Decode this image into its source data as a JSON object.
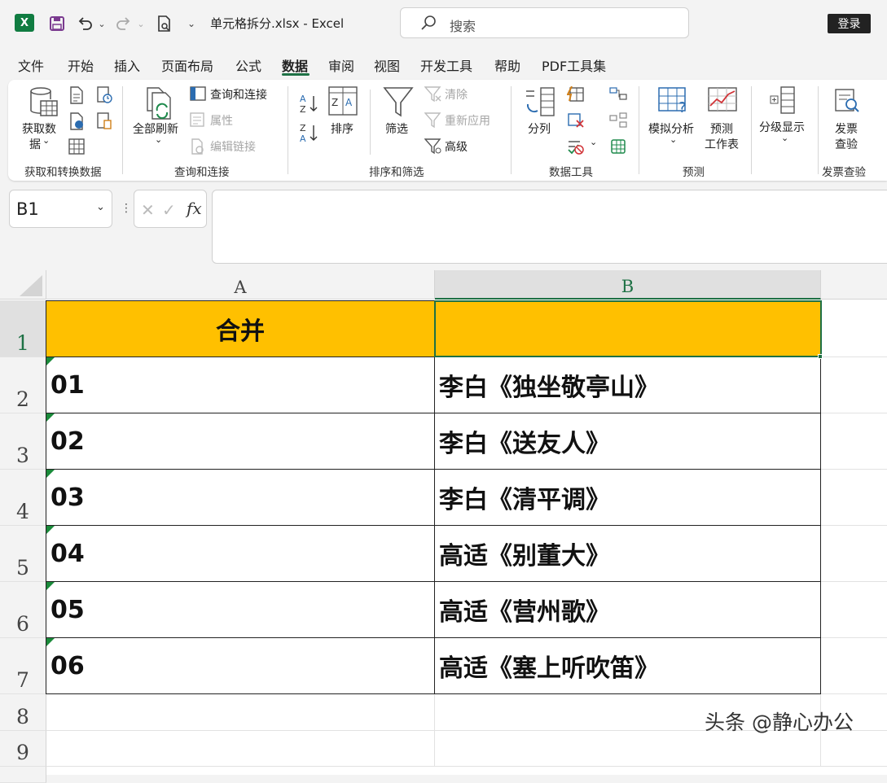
{
  "titlebar": {
    "app_logo": "X",
    "filename": "单元格拆分.xlsx  -  Excel",
    "search_placeholder": "搜索",
    "login": "登录"
  },
  "tabs": [
    "文件",
    "开始",
    "插入",
    "页面布局",
    "公式",
    "数据",
    "审阅",
    "视图",
    "开发工具",
    "帮助",
    "PDF工具集"
  ],
  "active_tab": "数据",
  "ribbon": {
    "get_data": "获取数",
    "get_data2": "据",
    "refresh_all": "全部刷新",
    "queries_connections": "查询和连接",
    "properties": "属性",
    "edit_links": "编辑链接",
    "sort": "排序",
    "filter": "筛选",
    "clear": "清除",
    "reapply": "重新应用",
    "advanced": "高级",
    "text_to_columns": "分列",
    "what_if": "模拟分析",
    "forecast_sheet": "预测",
    "forecast_sheet2": "工作表",
    "outline": "分级显示",
    "invoice_check": "发票",
    "invoice_check2": "查验",
    "groups": [
      "获取和转换数据",
      "查询和连接",
      "排序和筛选",
      "数据工具",
      "预测",
      "发票查验"
    ]
  },
  "formula_bar": {
    "name_box": "B1",
    "fx": "fx",
    "formula": ""
  },
  "sheet": {
    "columns": [
      "A",
      "B"
    ],
    "rows": [
      "1",
      "2",
      "3",
      "4",
      "5",
      "6",
      "7",
      "8",
      "9"
    ],
    "header_a": "合并",
    "header_b": "",
    "data": [
      [
        "01",
        "李白《独坐敬亭山》"
      ],
      [
        "02",
        "李白《送友人》"
      ],
      [
        "03",
        "李白《清平调》"
      ],
      [
        "04",
        "高适《别董大》"
      ],
      [
        "05",
        "高适《营州歌》"
      ],
      [
        "06",
        "高适《塞上听吹笛》"
      ]
    ],
    "selected_cell": "B1",
    "header_fill": "#ffc000"
  },
  "watermark": "头条 @静心办公"
}
